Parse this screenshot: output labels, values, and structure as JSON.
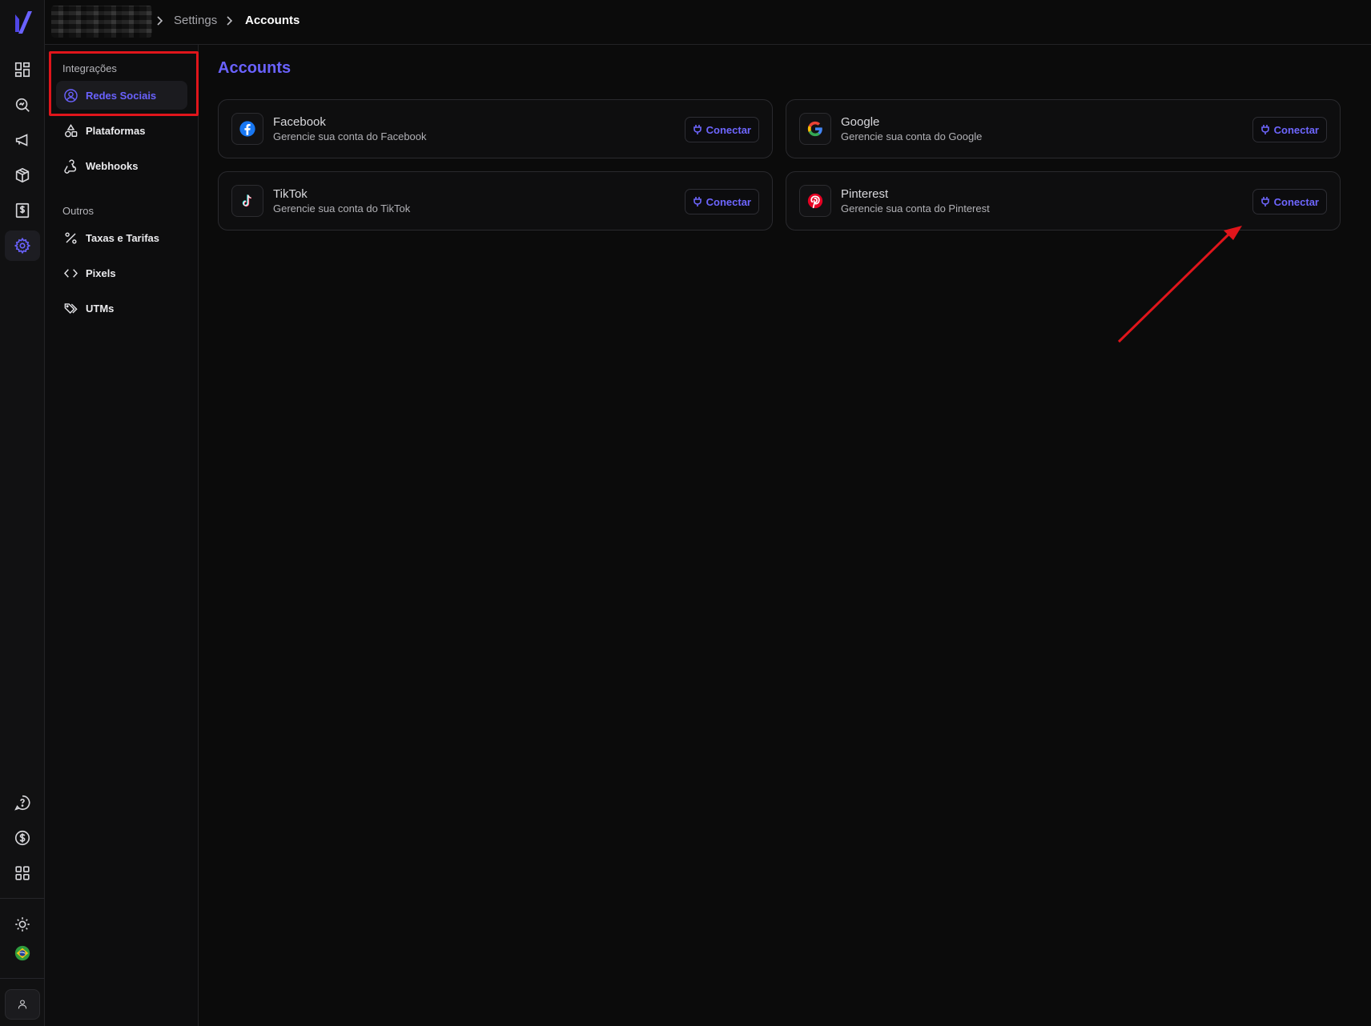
{
  "breadcrumb": {
    "items": [
      "Settings",
      "Accounts"
    ]
  },
  "sidebar": {
    "sections": [
      {
        "label": "Integrações",
        "items": [
          {
            "label": "Redes Sociais",
            "icon": "user-circle-icon",
            "active": true
          },
          {
            "label": "Plataformas",
            "icon": "shapes-icon"
          },
          {
            "label": "Webhooks",
            "icon": "webhook-icon"
          }
        ]
      },
      {
        "label": "Outros",
        "items": [
          {
            "label": "Taxas e Tarifas",
            "icon": "percent-icon"
          },
          {
            "label": "Pixels",
            "icon": "code-icon"
          },
          {
            "label": "UTMs",
            "icon": "tags-icon"
          }
        ]
      }
    ]
  },
  "page": {
    "title": "Accounts"
  },
  "accounts": [
    {
      "name": "Facebook",
      "description": "Gerencie sua conta do Facebook",
      "button": "Conectar",
      "icon": "facebook-icon"
    },
    {
      "name": "Google",
      "description": "Gerencie sua conta do Google",
      "button": "Conectar",
      "icon": "google-icon"
    },
    {
      "name": "TikTok",
      "description": "Gerencie sua conta do TikTok",
      "button": "Conectar",
      "icon": "tiktok-icon"
    },
    {
      "name": "Pinterest",
      "description": "Gerencie sua conta do Pinterest",
      "button": "Conectar",
      "icon": "pinterest-icon"
    }
  ],
  "colors": {
    "accent": "#6a62ff",
    "background": "#0b0b0b",
    "highlight": "#e0151b"
  }
}
